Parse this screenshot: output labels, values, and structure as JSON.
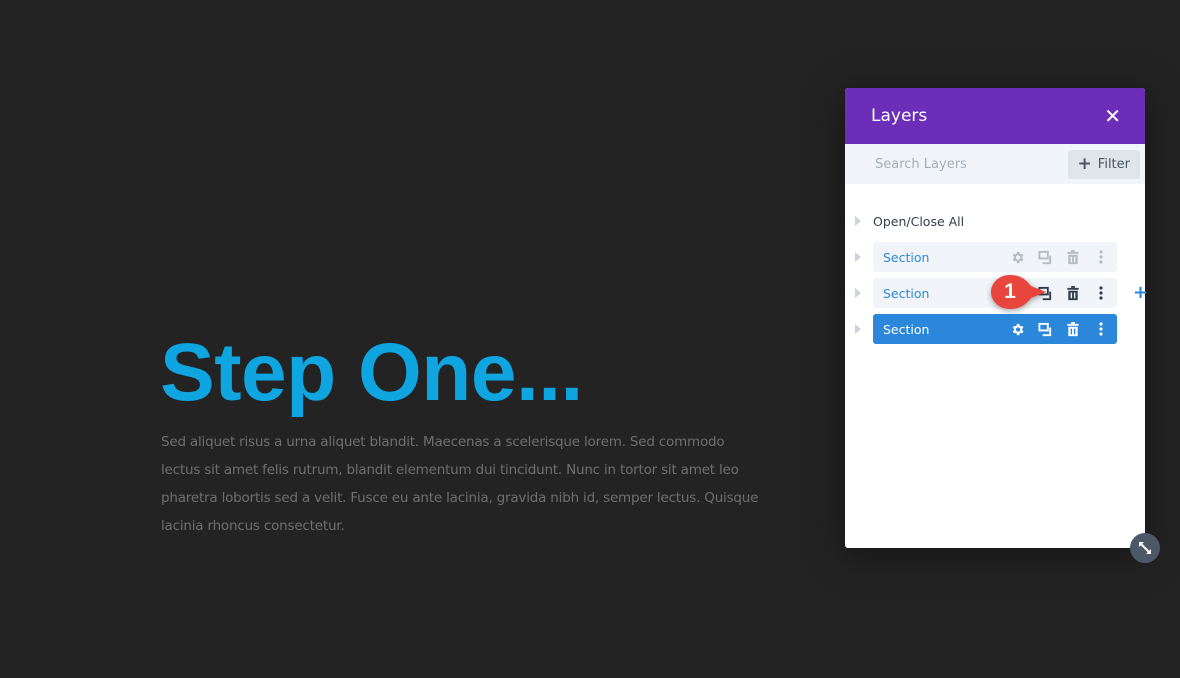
{
  "hero": {
    "title": "Step One...",
    "body": "Sed aliquet risus a urna aliquet blandit. Maecenas a scelerisque lorem. Sed commodo lectus sit amet felis rutrum, blandit elementum dui tincidunt. Nunc in tortor sit amet leo pharetra lobortis sed a velit. Fusce eu ante lacinia, gravida nibh id, semper lectus. Quisque lacinia rhoncus consectetur."
  },
  "layers_panel": {
    "title": "Layers",
    "close_icon": "close-icon",
    "search": {
      "placeholder": "Search Layers",
      "value": ""
    },
    "filter_label": "Filter",
    "toggle_all_label": "Open/Close All",
    "rows": [
      {
        "label": "Section",
        "state": "default"
      },
      {
        "label": "Section",
        "state": "hover"
      },
      {
        "label": "Section",
        "state": "active"
      }
    ],
    "callout_number": "1",
    "add_icon": "plus-icon",
    "resize_icon": "resize-icon"
  },
  "colors": {
    "accent_purple": "#6c2eb9",
    "accent_blue": "#2b87da",
    "hero_title": "#0ea5e0",
    "callout_red": "#e8453c"
  }
}
